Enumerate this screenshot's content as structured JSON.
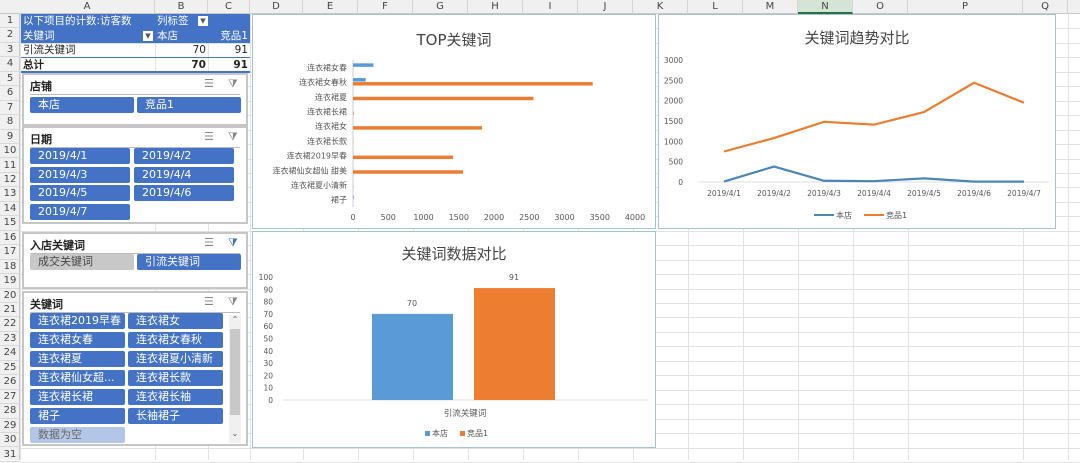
{
  "columns": [
    "A",
    "B",
    "C",
    "D",
    "E",
    "F",
    "G",
    "H",
    "I",
    "J",
    "K",
    "L",
    "M",
    "N",
    "O",
    "P",
    "Q"
  ],
  "rows": [
    "1",
    "2",
    "3",
    "4",
    "5",
    "6",
    "7",
    "8",
    "9",
    "10",
    "11",
    "12",
    "13",
    "14",
    "15",
    "16",
    "17",
    "18",
    "19",
    "20",
    "21",
    "22",
    "23",
    "24",
    "25",
    "26",
    "27",
    "28",
    "29",
    "30",
    "31"
  ],
  "pivot": {
    "header1": "以下项目的计数:访客数",
    "col_label": "列标签",
    "row_label": "关键词",
    "col1": "本店",
    "col2": "竞品1",
    "data_row": {
      "label": "引流关键词",
      "v1": "70",
      "v2": "91"
    },
    "total_row": {
      "label": "总计",
      "v1": "70",
      "v2": "91"
    }
  },
  "slicers": {
    "store": {
      "title": "店铺",
      "items": [
        "本店",
        "竞品1"
      ]
    },
    "date": {
      "title": "日期",
      "items": [
        "2019/4/1",
        "2019/4/2",
        "2019/4/3",
        "2019/4/4",
        "2019/4/5",
        "2019/4/6",
        "2019/4/7"
      ]
    },
    "entry": {
      "title": "入店关键词",
      "items": [
        "成交关键词",
        "引流关键词"
      ]
    },
    "keyword": {
      "title": "关键词",
      "items": [
        "连衣裙2019早春",
        "连衣裙女",
        "连衣裙女春",
        "连衣裙女春秋",
        "连衣裙夏",
        "连衣裙夏小清新",
        "连衣裙仙女超...",
        "连衣裙长款",
        "连衣裙长裙",
        "连衣裙长袖",
        "裙子",
        "长袖裙子"
      ],
      "empty_item": "数据为空"
    }
  },
  "colors": {
    "blue": "#5b9bd5",
    "orange": "#ed7d31",
    "slicer": "#4472c4"
  },
  "chart_data": [
    {
      "type": "bar",
      "orientation": "horizontal",
      "title": "TOP关键词",
      "categories": [
        "连衣裙女春",
        "连衣裙女春秋",
        "连衣裙夏",
        "连衣裙长裙",
        "连衣裙女",
        "连衣裙长款",
        "连衣裙2019早春",
        "连衣裙仙女超仙 甜美",
        "连衣裙夏小清新",
        "裙子"
      ],
      "series": [
        {
          "name": "本店",
          "values": [
            290,
            180,
            0,
            0,
            0,
            0,
            0,
            0,
            0,
            10
          ]
        },
        {
          "name": "竞品1",
          "values": [
            0,
            3400,
            2560,
            10,
            1830,
            5,
            1420,
            1560,
            5,
            0
          ]
        }
      ],
      "xlim": [
        0,
        4000
      ],
      "ticks": [
        "0",
        "500",
        "1000",
        "1500",
        "2000",
        "2500",
        "3000",
        "3500",
        "4000"
      ],
      "legend": "none"
    },
    {
      "type": "line",
      "title": "关键词趋势对比",
      "x": [
        "2019/4/1",
        "2019/4/2",
        "2019/4/3",
        "2019/4/4",
        "2019/4/5",
        "2019/4/6",
        "2019/4/7"
      ],
      "series": [
        {
          "name": "本店",
          "values": [
            10,
            380,
            30,
            20,
            90,
            10,
            10
          ]
        },
        {
          "name": "竞品1",
          "values": [
            750,
            1080,
            1480,
            1410,
            1720,
            2440,
            1950
          ]
        }
      ],
      "ylim": [
        0,
        3000
      ],
      "ticks": [
        "0",
        "500",
        "1000",
        "1500",
        "2000",
        "2500",
        "3000"
      ],
      "legend": "bottom"
    },
    {
      "type": "bar",
      "title": "关键词数据对比",
      "categories": [
        "引流关键词"
      ],
      "series": [
        {
          "name": "本店",
          "values": [
            70
          ]
        },
        {
          "name": "竞品1",
          "values": [
            91
          ]
        }
      ],
      "data_labels": [
        "70",
        "91"
      ],
      "ylim": [
        0,
        100
      ],
      "ticks": [
        "0",
        "10",
        "20",
        "30",
        "40",
        "50",
        "60",
        "70",
        "80",
        "90",
        "100"
      ],
      "legend": "bottom"
    }
  ]
}
